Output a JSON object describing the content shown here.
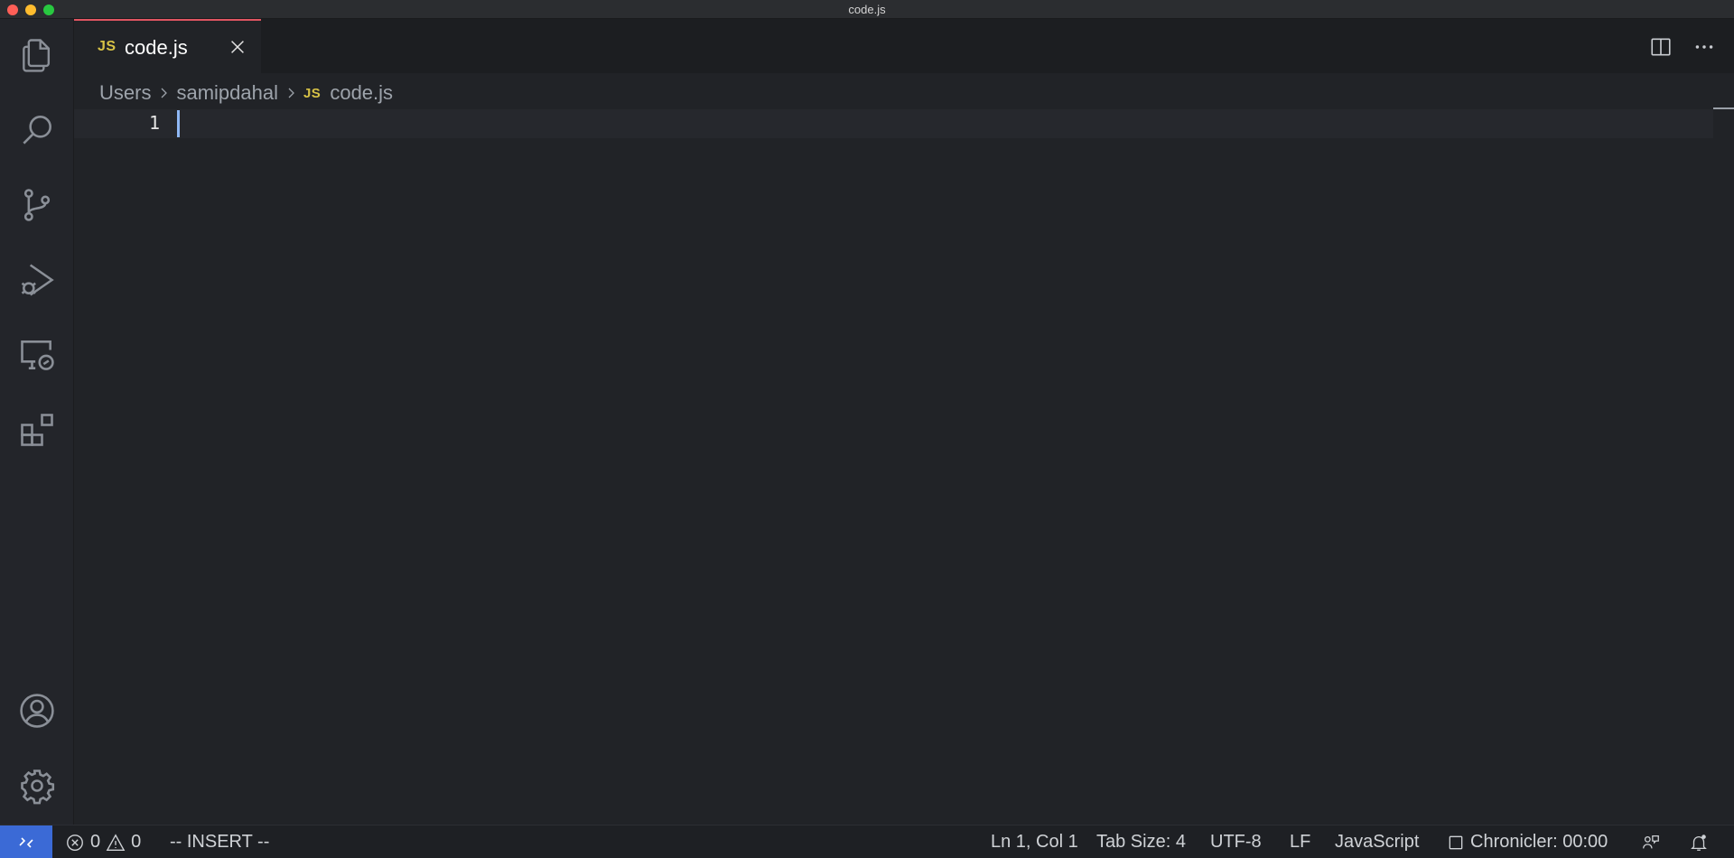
{
  "window": {
    "title": "code.js"
  },
  "activity_bar": {
    "items": [
      {
        "icon": "files-icon",
        "label": "Explorer"
      },
      {
        "icon": "search-icon",
        "label": "Search"
      },
      {
        "icon": "source-control-icon",
        "label": "Source Control"
      },
      {
        "icon": "run-debug-icon",
        "label": "Run and Debug"
      },
      {
        "icon": "remote-explorer-icon",
        "label": "Remote Explorer"
      },
      {
        "icon": "extensions-icon",
        "label": "Extensions"
      }
    ],
    "bottom": [
      {
        "icon": "account-icon"
      },
      {
        "icon": "gear-icon"
      }
    ]
  },
  "tabs": [
    {
      "badge": "JS",
      "label": "code.js",
      "active": true
    }
  ],
  "breadcrumbs": {
    "segments": [
      "Users",
      "samipdahal"
    ],
    "file_badge": "JS",
    "file": "code.js"
  },
  "editor": {
    "line_numbers": [
      "1"
    ],
    "lines": [
      ""
    ]
  },
  "status_bar": {
    "errors": "0",
    "warnings": "0",
    "mode": "-- INSERT --",
    "cursor_position": "Ln 1, Col 1",
    "tab_size": "Tab Size: 4",
    "encoding": "UTF-8",
    "eol": "LF",
    "language": "JavaScript",
    "chronicler": "Chronicler: 00:00"
  },
  "colors": {
    "accent_tab_border": "#e05561",
    "js_badge": "#d7c246",
    "remote_button": "#3b6ad6",
    "cursor": "#8fb8f5"
  }
}
